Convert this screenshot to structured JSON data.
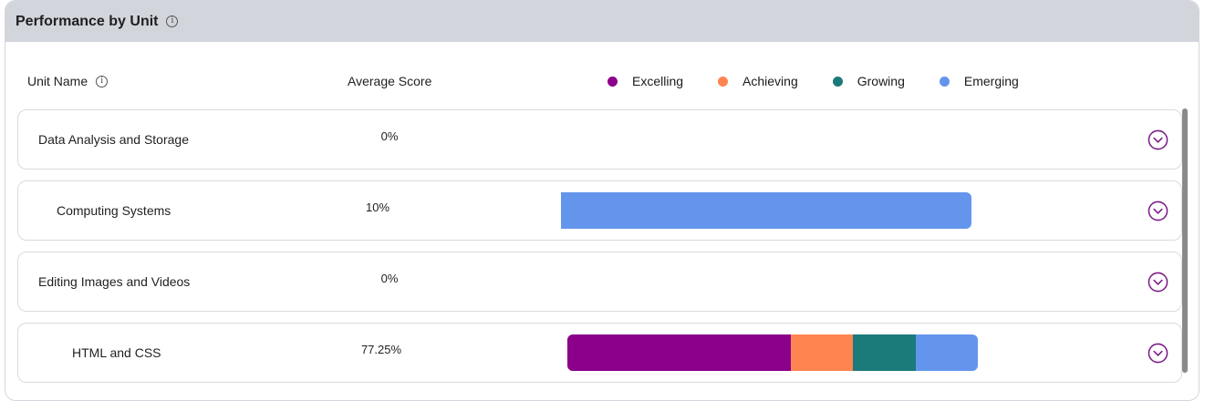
{
  "header": {
    "title": "Performance by Unit",
    "info_icon": "info-icon"
  },
  "columns": {
    "unit_name": "Unit Name",
    "average_score": "Average Score"
  },
  "legend": [
    {
      "label": "Excelling",
      "color": "#8b008b"
    },
    {
      "label": "Achieving",
      "color": "#ff8450"
    },
    {
      "label": "Growing",
      "color": "#1b7a7a"
    },
    {
      "label": "Emerging",
      "color": "#6495ed"
    }
  ],
  "rows": [
    {
      "name": "Data Analysis and Storage",
      "score": "0%",
      "segments": []
    },
    {
      "name": "Computing Systems",
      "score": "10%",
      "segments": [
        {
          "level": "Emerging",
          "fraction": 1.0
        }
      ]
    },
    {
      "name": "Editing Images and Videos",
      "score": "0%",
      "segments": []
    },
    {
      "name": "HTML and CSS",
      "score": "77.25%",
      "segments": [
        {
          "level": "Excelling",
          "fraction": 0.544
        },
        {
          "level": "Achieving",
          "fraction": 0.152
        },
        {
          "level": "Growing",
          "fraction": 0.152
        },
        {
          "level": "Emerging",
          "fraction": 0.152
        }
      ]
    }
  ],
  "icons": {
    "expand": "chevron-down-circle-icon"
  }
}
